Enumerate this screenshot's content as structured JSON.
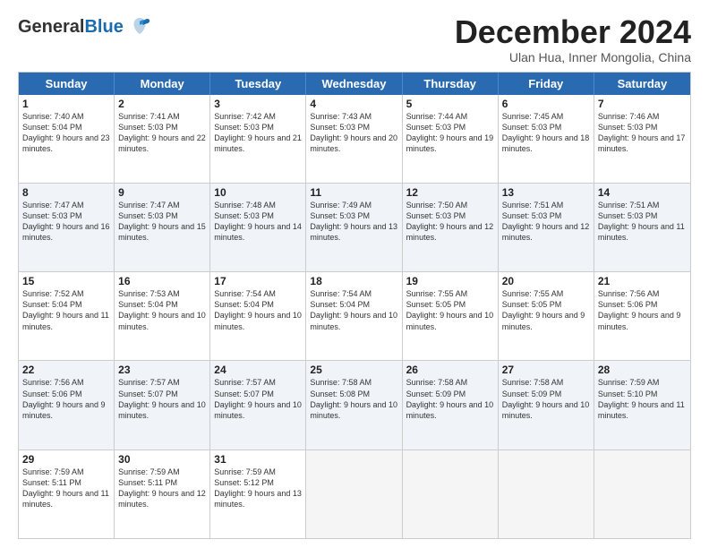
{
  "header": {
    "logo_general": "General",
    "logo_blue": "Blue",
    "month_title": "December 2024",
    "subtitle": "Ulan Hua, Inner Mongolia, China"
  },
  "weekdays": [
    "Sunday",
    "Monday",
    "Tuesday",
    "Wednesday",
    "Thursday",
    "Friday",
    "Saturday"
  ],
  "rows": [
    [
      {
        "day": "1",
        "rise": "Sunrise: 7:40 AM",
        "set": "Sunset: 5:04 PM",
        "daylight": "Daylight: 9 hours and 23 minutes."
      },
      {
        "day": "2",
        "rise": "Sunrise: 7:41 AM",
        "set": "Sunset: 5:03 PM",
        "daylight": "Daylight: 9 hours and 22 minutes."
      },
      {
        "day": "3",
        "rise": "Sunrise: 7:42 AM",
        "set": "Sunset: 5:03 PM",
        "daylight": "Daylight: 9 hours and 21 minutes."
      },
      {
        "day": "4",
        "rise": "Sunrise: 7:43 AM",
        "set": "Sunset: 5:03 PM",
        "daylight": "Daylight: 9 hours and 20 minutes."
      },
      {
        "day": "5",
        "rise": "Sunrise: 7:44 AM",
        "set": "Sunset: 5:03 PM",
        "daylight": "Daylight: 9 hours and 19 minutes."
      },
      {
        "day": "6",
        "rise": "Sunrise: 7:45 AM",
        "set": "Sunset: 5:03 PM",
        "daylight": "Daylight: 9 hours and 18 minutes."
      },
      {
        "day": "7",
        "rise": "Sunrise: 7:46 AM",
        "set": "Sunset: 5:03 PM",
        "daylight": "Daylight: 9 hours and 17 minutes."
      }
    ],
    [
      {
        "day": "8",
        "rise": "Sunrise: 7:47 AM",
        "set": "Sunset: 5:03 PM",
        "daylight": "Daylight: 9 hours and 16 minutes."
      },
      {
        "day": "9",
        "rise": "Sunrise: 7:47 AM",
        "set": "Sunset: 5:03 PM",
        "daylight": "Daylight: 9 hours and 15 minutes."
      },
      {
        "day": "10",
        "rise": "Sunrise: 7:48 AM",
        "set": "Sunset: 5:03 PM",
        "daylight": "Daylight: 9 hours and 14 minutes."
      },
      {
        "day": "11",
        "rise": "Sunrise: 7:49 AM",
        "set": "Sunset: 5:03 PM",
        "daylight": "Daylight: 9 hours and 13 minutes."
      },
      {
        "day": "12",
        "rise": "Sunrise: 7:50 AM",
        "set": "Sunset: 5:03 PM",
        "daylight": "Daylight: 9 hours and 12 minutes."
      },
      {
        "day": "13",
        "rise": "Sunrise: 7:51 AM",
        "set": "Sunset: 5:03 PM",
        "daylight": "Daylight: 9 hours and 12 minutes."
      },
      {
        "day": "14",
        "rise": "Sunrise: 7:51 AM",
        "set": "Sunset: 5:03 PM",
        "daylight": "Daylight: 9 hours and 11 minutes."
      }
    ],
    [
      {
        "day": "15",
        "rise": "Sunrise: 7:52 AM",
        "set": "Sunset: 5:04 PM",
        "daylight": "Daylight: 9 hours and 11 minutes."
      },
      {
        "day": "16",
        "rise": "Sunrise: 7:53 AM",
        "set": "Sunset: 5:04 PM",
        "daylight": "Daylight: 9 hours and 10 minutes."
      },
      {
        "day": "17",
        "rise": "Sunrise: 7:54 AM",
        "set": "Sunset: 5:04 PM",
        "daylight": "Daylight: 9 hours and 10 minutes."
      },
      {
        "day": "18",
        "rise": "Sunrise: 7:54 AM",
        "set": "Sunset: 5:04 PM",
        "daylight": "Daylight: 9 hours and 10 minutes."
      },
      {
        "day": "19",
        "rise": "Sunrise: 7:55 AM",
        "set": "Sunset: 5:05 PM",
        "daylight": "Daylight: 9 hours and 10 minutes."
      },
      {
        "day": "20",
        "rise": "Sunrise: 7:55 AM",
        "set": "Sunset: 5:05 PM",
        "daylight": "Daylight: 9 hours and 9 minutes."
      },
      {
        "day": "21",
        "rise": "Sunrise: 7:56 AM",
        "set": "Sunset: 5:06 PM",
        "daylight": "Daylight: 9 hours and 9 minutes."
      }
    ],
    [
      {
        "day": "22",
        "rise": "Sunrise: 7:56 AM",
        "set": "Sunset: 5:06 PM",
        "daylight": "Daylight: 9 hours and 9 minutes."
      },
      {
        "day": "23",
        "rise": "Sunrise: 7:57 AM",
        "set": "Sunset: 5:07 PM",
        "daylight": "Daylight: 9 hours and 10 minutes."
      },
      {
        "day": "24",
        "rise": "Sunrise: 7:57 AM",
        "set": "Sunset: 5:07 PM",
        "daylight": "Daylight: 9 hours and 10 minutes."
      },
      {
        "day": "25",
        "rise": "Sunrise: 7:58 AM",
        "set": "Sunset: 5:08 PM",
        "daylight": "Daylight: 9 hours and 10 minutes."
      },
      {
        "day": "26",
        "rise": "Sunrise: 7:58 AM",
        "set": "Sunset: 5:09 PM",
        "daylight": "Daylight: 9 hours and 10 minutes."
      },
      {
        "day": "27",
        "rise": "Sunrise: 7:58 AM",
        "set": "Sunset: 5:09 PM",
        "daylight": "Daylight: 9 hours and 10 minutes."
      },
      {
        "day": "28",
        "rise": "Sunrise: 7:59 AM",
        "set": "Sunset: 5:10 PM",
        "daylight": "Daylight: 9 hours and 11 minutes."
      }
    ],
    [
      {
        "day": "29",
        "rise": "Sunrise: 7:59 AM",
        "set": "Sunset: 5:11 PM",
        "daylight": "Daylight: 9 hours and 11 minutes."
      },
      {
        "day": "30",
        "rise": "Sunrise: 7:59 AM",
        "set": "Sunset: 5:11 PM",
        "daylight": "Daylight: 9 hours and 12 minutes."
      },
      {
        "day": "31",
        "rise": "Sunrise: 7:59 AM",
        "set": "Sunset: 5:12 PM",
        "daylight": "Daylight: 9 hours and 13 minutes."
      },
      null,
      null,
      null,
      null
    ]
  ],
  "alt_rows": [
    1,
    3
  ]
}
